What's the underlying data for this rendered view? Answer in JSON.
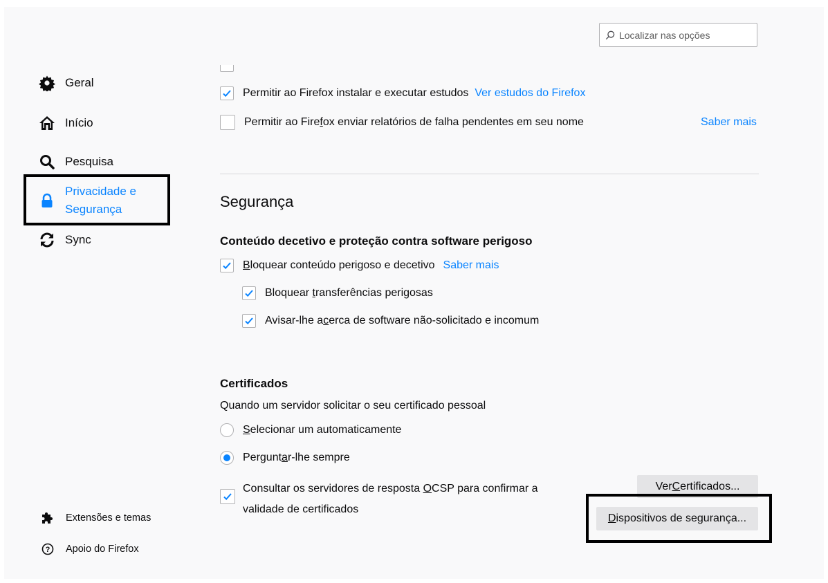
{
  "search": {
    "placeholder": "Localizar nas opções"
  },
  "sidebar": {
    "items": [
      {
        "label": "Geral",
        "icon": "gear-icon"
      },
      {
        "label": "Início",
        "icon": "home-icon"
      },
      {
        "label": "Pesquisa",
        "icon": "search-icon"
      },
      {
        "label_line1": "Privacidade e",
        "label_line2": "Segurança",
        "icon": "lock-icon",
        "active": true
      },
      {
        "label": "Sync",
        "icon": "sync-icon"
      }
    ],
    "footer": [
      {
        "label": "Extensões e temas",
        "icon": "puzzle-icon"
      },
      {
        "label": "Apoio do Firefox",
        "icon": "help-icon"
      }
    ]
  },
  "data_collection": {
    "studies": {
      "label": "Permitir ao Firefox instalar e executar estudos",
      "checked": true,
      "link": "Ver estudos do Firefox"
    },
    "crash_reports": {
      "label_pre": "Permitir ao Fire",
      "label_u": "f",
      "label_post": "ox enviar relatórios de falha pendentes em seu nome",
      "checked": false,
      "link": "Saber mais"
    }
  },
  "security": {
    "title": "Segurança",
    "deceptive": {
      "title": "Conteúdo decetivo e proteção contra software perigoso",
      "block_dangerous": {
        "label_u": "B",
        "label_rest": "loquear conteúdo perigoso e decetivo",
        "checked": true,
        "link": "Saber mais"
      },
      "block_downloads": {
        "label_pre": "Bloquear ",
        "label_u": "t",
        "label_post": "ransferências perigosas",
        "checked": true
      },
      "warn_unwanted": {
        "label_pre": "Avisar-lhe a",
        "label_u": "c",
        "label_post": "erca de software não-solicitado e incomum",
        "checked": true
      }
    },
    "certificates": {
      "title": "Certificados",
      "prompt": "Quando um servidor solicitar o seu certificado pessoal",
      "auto_select": {
        "label_u": "S",
        "label_rest": "elecionar um automaticamente",
        "selected": false
      },
      "ask_always": {
        "label_pre": "Pergunt",
        "label_u": "a",
        "label_post": "r-lhe sempre",
        "selected": true
      },
      "ocsp": {
        "line1_pre": "Consultar os servidores de resposta ",
        "line1_u": "O",
        "line1_post": "CSP para confirmar a",
        "line2": "validade de certificados",
        "checked": true
      },
      "view_button": {
        "label_u": "C",
        "label_pre": "Ver ",
        "label_post": "ertificados..."
      },
      "devices_button": {
        "label_u": "D",
        "label_rest": "ispositivos de segurança..."
      }
    }
  },
  "colors": {
    "accent": "#0a84ff",
    "background": "#f9f9fa",
    "button": "#e4e4e6",
    "highlight_border": "#000000"
  }
}
